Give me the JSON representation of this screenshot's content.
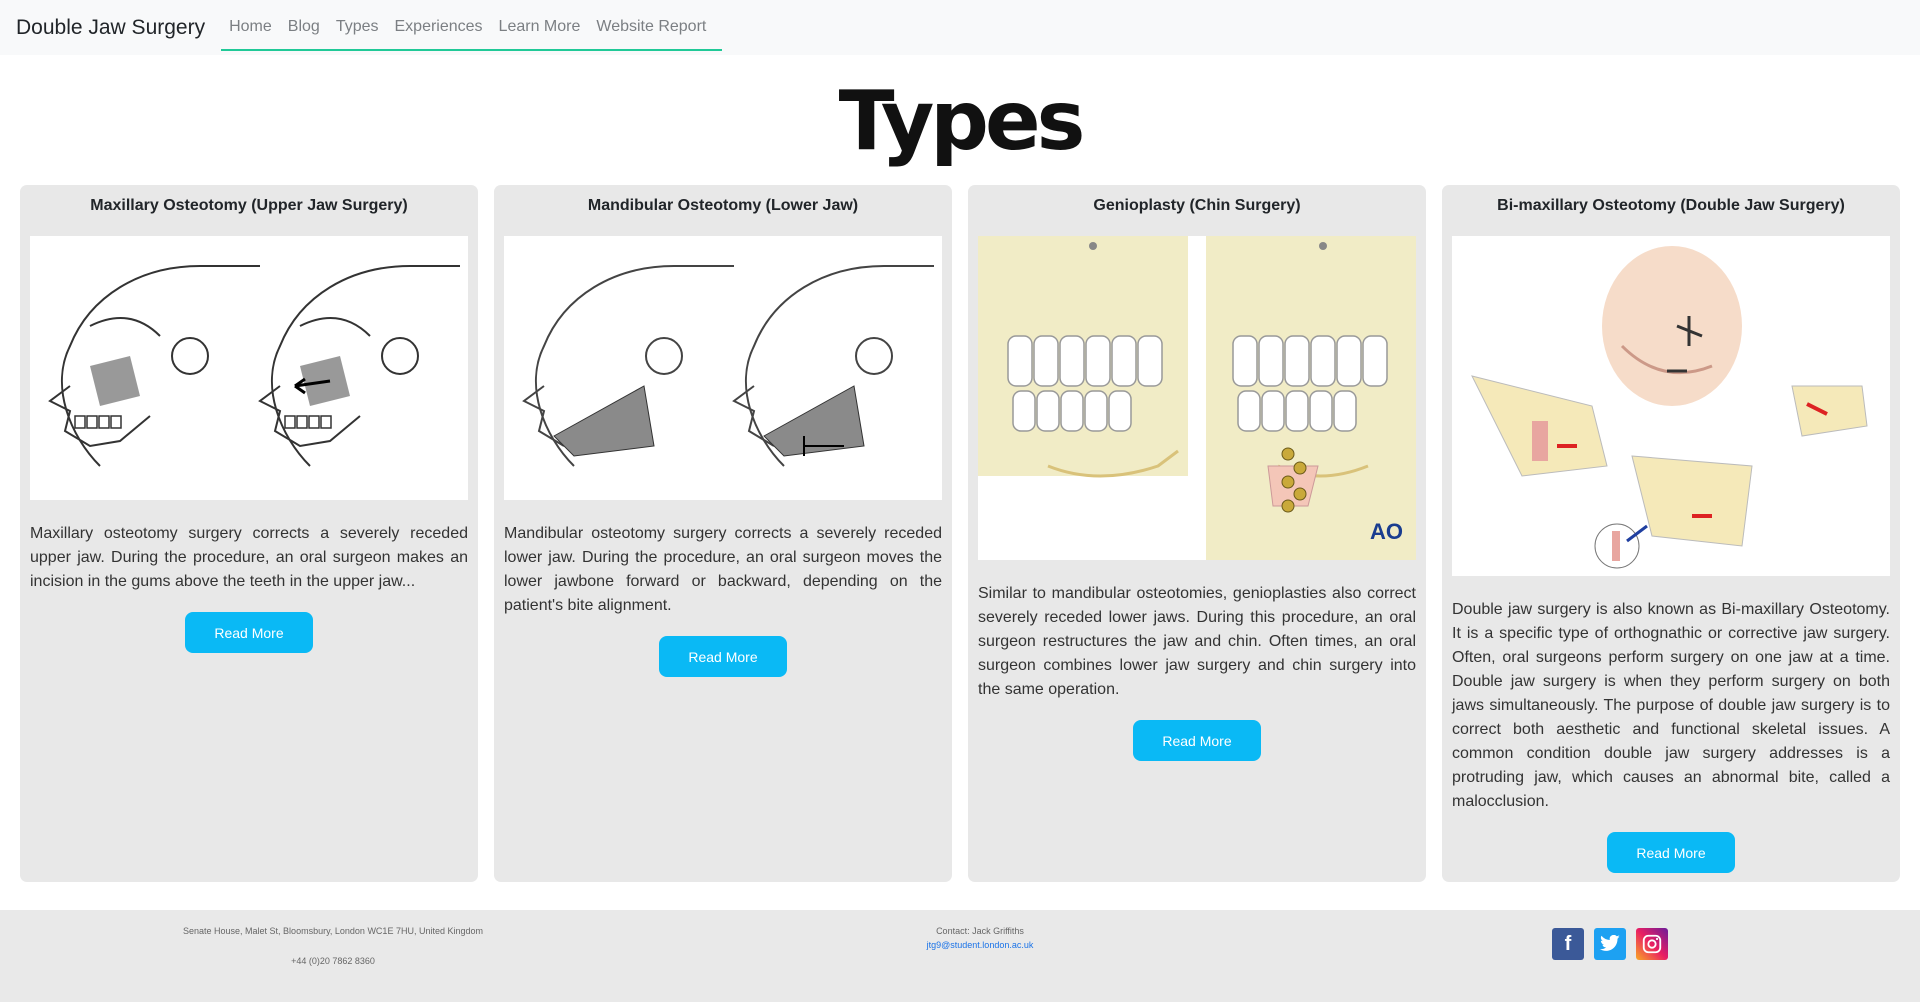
{
  "nav": {
    "brand": "Double Jaw Surgery",
    "links": [
      "Home",
      "Blog",
      "Types",
      "Experiences",
      "Learn More",
      "Website Report"
    ]
  },
  "page_title": "Types",
  "cards": [
    {
      "title": "Maxillary Osteotomy (Upper Jaw Surgery)",
      "text": "Maxillary osteotomy surgery corrects a severely receded upper jaw. During the procedure, an oral surgeon makes an incision in the gums above the teeth in the upper jaw...",
      "button": "Read More"
    },
    {
      "title": "Mandibular Osteotomy (Lower Jaw)",
      "text": "Mandibular osteotomy surgery corrects a severely receded lower jaw. During the procedure, an oral surgeon moves the lower jawbone forward or backward, depending on the patient's bite alignment.",
      "button": "Read More"
    },
    {
      "title": "Genioplasty (Chin Surgery)",
      "text": "Similar to mandibular osteotomies, genioplasties also correct severely receded lower jaws. During this procedure, an oral surgeon restructures the jaw and chin. Often times, an oral surgeon combines lower jaw surgery and chin surgery into the same operation.",
      "button": "Read More",
      "image_logo": "AO"
    },
    {
      "title": "Bi-maxillary Osteotomy (Double Jaw Surgery)",
      "text": "Double jaw surgery is also known as Bi-maxillary Osteotomy. It is a specific type of orthognathic or corrective jaw surgery. Often, oral surgeons perform surgery on one jaw at a time. Double jaw surgery is when they perform surgery on both jaws simultaneously. The purpose of double jaw surgery is to correct both aesthetic and functional skeletal issues. A common condition double jaw surgery addresses is a protruding jaw, which causes an abnormal bite, called a malocclusion.",
      "button": "Read More"
    }
  ],
  "footer": {
    "address": "Senate House, Malet St, Bloomsbury, London WC1E 7HU, United Kingdom",
    "phone": "+44 (0)20 7862 8360",
    "contact": "Contact: Jack Griffiths",
    "email": "jtg9@student.london.ac.uk",
    "social_icons": [
      "facebook-icon",
      "twitter-icon",
      "instagram-icon"
    ],
    "social_colors": {
      "facebook": "#3b5998",
      "twitter": "#1da1f2",
      "instagram": "#c13584"
    }
  },
  "colors": {
    "accent": "#0ab9f5",
    "nav_underline": "#20c997",
    "card_bg": "#e8e8e8"
  }
}
